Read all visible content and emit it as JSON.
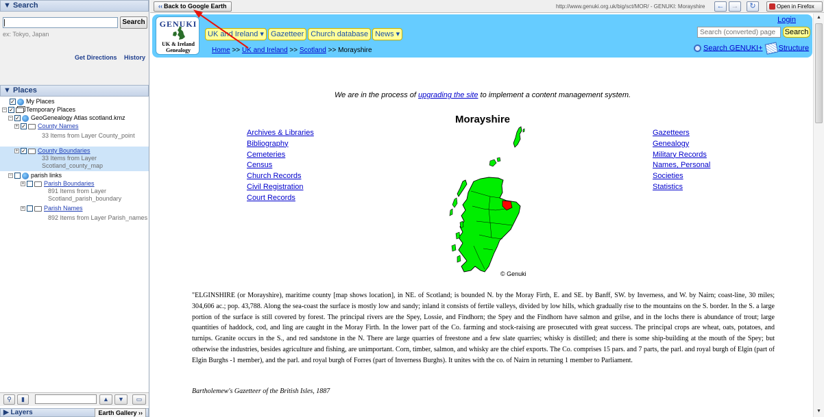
{
  "search_panel": {
    "header": "▼ Search",
    "input_value": "|",
    "search_button": "Search",
    "hint": "ex: Tokyo, Japan",
    "get_directions": "Get Directions",
    "history": "History"
  },
  "places_panel": {
    "header": "▼ Places",
    "items": [
      {
        "label": "My Places"
      },
      {
        "label": "Temporary Places"
      },
      {
        "label": "GeoGenealogy Atlas scotland.kmz"
      },
      {
        "label": "County Names",
        "sub": "33 Items from Layer County_point"
      },
      {
        "label": "County Boundaries",
        "sub1": "33 Items from Layer",
        "sub2": "Scotland_county_map"
      },
      {
        "label": "parish links"
      },
      {
        "label": "Parish Boundaries",
        "sub1": "891 Items from Layer",
        "sub2": "Scotland_parish_boundary"
      },
      {
        "label": "Parish Names",
        "sub": "892 Items from Layer Parish_names"
      }
    ]
  },
  "layers_bar": {
    "label": "▶ Layers",
    "gallery_button": "Earth Gallery ››"
  },
  "browser_bar": {
    "back_button": "Back to Google Earth",
    "back_arrow": "‹‹",
    "url": "http://www.genuki.org.uk/big/sct/MOR/ - GENUKI: Morayshire",
    "open_in_firefox": "Open in Firefox"
  },
  "genuki": {
    "logo_title": "GENUKI",
    "logo_sub_line1": "UK & Ireland",
    "logo_sub_line2": "Genealogy",
    "menu": [
      "UK and Ireland ▾",
      "Gazetteer",
      "Church database",
      "News ▾"
    ],
    "breadcrumb": [
      "Home",
      "UK and Ireland",
      "Scotland",
      "Morayshire"
    ],
    "breadcrumb_sep": " >> ",
    "login": "Login",
    "search_placeholder": "Search (converted) page",
    "search_button": "Search",
    "search_genuki": "Search GENUKI+",
    "structure": "Structure"
  },
  "page": {
    "notice_pre": "We are in the process of ",
    "notice_link": "upgrading the site",
    "notice_post": " to implement a content management system.",
    "title": "Morayshire",
    "left_links": [
      "Archives & Libraries",
      "Bibliography",
      "Cemeteries",
      "Census",
      "Church Records",
      "Civil Registration",
      "Court Records"
    ],
    "right_links": [
      "Gazetteers",
      "Genealogy",
      "Military Records",
      "Names, Personal",
      "Societies",
      "Statistics"
    ],
    "map_credit": "© Genuki",
    "description": "\"ELGINSHIRE (or Morayshire), maritime county [map shows location], in NE. of Scotland; is bounded N. by the Moray Firth, E. and SE. by Banff, SW. by Inverness, and W. by Nairn; coast-line, 30 miles; 304,606 ac.; pop. 43,788. Along the sea-coast the surface is mostly low and sandy; inland it consists of fertile valleys, divided by low hills, which gradually rise to the mountains on the S. border. In the S. a large portion of the surface is still covered by forest. The principal rivers are the Spey, Lossie, and Findhorn; the Spey and the Findhorn have salmon and grilse, and in the lochs there is abundance of trout; large quantities of haddock, cod, and ling are caught in the Moray Firth. In the lower part of the Co. farming and stock-raising are prosecuted with great success. The principal crops are wheat, oats, potatoes, and turnips. Granite occurs in the S., and red sandstone in the N. There are large quarries of freestone and a few slate quarries; whisky is distilled; and there is some ship-building at the mouth of the Spey; but otherwise the industries, besides agriculture and fishing, are unimportant. Corn, timber, salmon, and whisky are the chief exports. The Co. comprises 15 pars. and 7 parts, the parl. and royal burgh of Elgin (part of Elgin Burghs -1 member), and the parl. and royal burgh of Forres (part of Inverness Burghs). It unites with the co. of Nairn in returning 1 member to Parliament.",
    "source": "Bartholemew's Gazetteer of the British Isles, 1887"
  },
  "colors": {
    "header_bg": "#66ccff",
    "menu_bg": "#ffff99",
    "map_green": "#00ee00",
    "highlight_red": "#ff0000",
    "link": "#0000cc"
  }
}
